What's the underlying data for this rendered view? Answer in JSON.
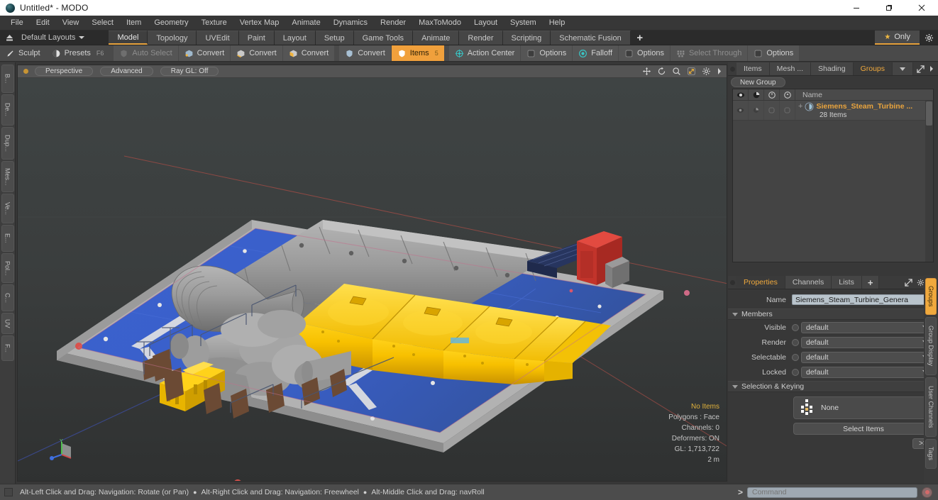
{
  "window": {
    "title": "Untitled* - MODO",
    "app_icon": "modo-logo-icon",
    "minimize": "minimize-icon",
    "maximize": "restore-icon",
    "close": "close-icon"
  },
  "menubar": {
    "items": [
      "File",
      "Edit",
      "View",
      "Select",
      "Item",
      "Geometry",
      "Texture",
      "Vertex Map",
      "Animate",
      "Dynamics",
      "Render",
      "MaxToModo",
      "Layout",
      "System",
      "Help"
    ]
  },
  "layoutbar": {
    "home_icon": "eject-icon",
    "layouts_label": "Default Layouts",
    "tabs": [
      {
        "label": "Model",
        "active": true
      },
      {
        "label": "Topology",
        "active": false
      },
      {
        "label": "UVEdit",
        "active": false
      },
      {
        "label": "Paint",
        "active": false
      },
      {
        "label": "Layout",
        "active": false
      },
      {
        "label": "Setup",
        "active": false
      },
      {
        "label": "Game Tools",
        "active": false
      },
      {
        "label": "Animate",
        "active": false
      },
      {
        "label": "Render",
        "active": false
      },
      {
        "label": "Scripting",
        "active": false
      },
      {
        "label": "Schematic Fusion",
        "active": false
      }
    ],
    "add_label": "+",
    "only_label": "Only",
    "only_star": "star-icon",
    "gear_icon": "gear-icon",
    "accent": "#e8a33d"
  },
  "toolbar": {
    "sculpt": {
      "label": "Sculpt",
      "icon": "brush-icon"
    },
    "presets": {
      "label": "Presets",
      "shortcut": "F6",
      "icon": "sphere-icon"
    },
    "auto_select": {
      "label": "Auto Select",
      "icon": "shield-icon",
      "enabled": false
    },
    "convert1": {
      "label": "Convert",
      "icon": "cube-vertex-icon"
    },
    "convert2": {
      "label": "Convert",
      "icon": "cube-edge-icon"
    },
    "convert3": {
      "label": "Convert",
      "icon": "cube-poly-icon"
    },
    "convert4": {
      "label": "Convert",
      "icon": "shield-icon"
    },
    "items": {
      "label": "Items",
      "shortcut": "5",
      "icon": "shield-icon",
      "selected": true
    },
    "action_center": {
      "label": "Action Center",
      "icon": "target-icon"
    },
    "options1": {
      "label": "Options",
      "icon": "checkbox-icon"
    },
    "falloff": {
      "label": "Falloff",
      "icon": "radio-icon"
    },
    "options2": {
      "label": "Options",
      "icon": "checkbox-icon"
    },
    "select_through": {
      "label": "Select Through",
      "icon": "dots-icon",
      "enabled": false
    },
    "options3": {
      "label": "Options",
      "icon": "checkbox-icon"
    }
  },
  "left_tabs": [
    {
      "label": "B..."
    },
    {
      "label": "De..."
    },
    {
      "label": "Dup..."
    },
    {
      "label": "Mes..."
    },
    {
      "label": "Ve..."
    },
    {
      "label": "E..."
    },
    {
      "label": "Pol..."
    },
    {
      "label": "C..."
    },
    {
      "label": "UV"
    },
    {
      "label": "F..."
    }
  ],
  "viewport": {
    "indicator": "active-view-dot",
    "mode": "Perspective",
    "shading": "Advanced",
    "raygl": "Ray GL: Off",
    "header_icons": [
      "move-icon",
      "rotate-icon",
      "zoom-icon",
      "fit-icon",
      "gear-icon",
      "chevron-right-icon"
    ],
    "gizmo": "axis-gizmo",
    "stats": {
      "selection": "No Items",
      "polygons": "Polygons : Face",
      "channels": "Channels: 0",
      "deformers": "Deformers: ON",
      "gl": "GL: 1,713,722",
      "scale": "2 m"
    },
    "scene": {
      "model_name": "Siemens Steam Turbine Generator",
      "deck_color": "#3b5fc4",
      "turbine_color": "#f5c400",
      "casing_color": "#9a9a9a",
      "accent_red": "#c5322b",
      "slab_color": "#b9b9b9",
      "bg_color": "#3a3a3a"
    }
  },
  "right_panel": {
    "tabs": [
      {
        "label": "Items",
        "active": false
      },
      {
        "label": "Mesh ...",
        "active": false
      },
      {
        "label": "Shading",
        "active": false
      },
      {
        "label": "Groups",
        "active": true
      }
    ],
    "tab_overflow_icon": "chevron-down-icon",
    "expand_icon": "expand-icon",
    "more_icon": "chevron-right-icon",
    "new_group_label": "New Group",
    "tree": {
      "column_icons": [
        "eye-icon",
        "render-icon",
        "lock-icon",
        "selectable-icon"
      ],
      "name_header": "Name",
      "rows": [
        {
          "expander": "+",
          "icon": "group-icon",
          "title": "Siemens_Steam_Turbine ...",
          "subtitle": "28 Items"
        }
      ]
    }
  },
  "properties": {
    "tabs": [
      {
        "label": "Properties",
        "active": true
      },
      {
        "label": "Channels",
        "active": false
      },
      {
        "label": "Lists",
        "active": false
      },
      {
        "label": "+",
        "active": false
      }
    ],
    "expand_icon": "expand-icon",
    "gear_icon": "gear-icon",
    "more_icon": "chevron-right-icon",
    "name_label": "Name",
    "name_value": "Siemens_Steam_Turbine_Genera",
    "members_section": "Members",
    "fields": [
      {
        "label": "Visible",
        "value": "default"
      },
      {
        "label": "Render",
        "value": "default"
      },
      {
        "label": "Selectable",
        "value": "default"
      },
      {
        "label": "Locked",
        "value": "default"
      }
    ],
    "selection_section": "Selection & Keying",
    "selection_value": "None",
    "selection_icon": "item-tree-icon",
    "select_items_label": "Select Items",
    "more_button_label": ">>"
  },
  "right_tabs": [
    {
      "label": "Groups",
      "active": true
    },
    {
      "label": "Group Display",
      "active": false
    },
    {
      "label": "User Channels",
      "active": false
    },
    {
      "label": "Tags",
      "active": false
    }
  ],
  "statusbar": {
    "hint1": "Alt-Left Click and Drag: Navigation: Rotate (or Pan)",
    "hint2": "Alt-Right Click and Drag: Navigation: Freewheel",
    "hint3": "Alt-Middle Click and Drag: navRoll",
    "prompt": ">",
    "command_placeholder": "Command",
    "record_icon": "record-icon"
  }
}
